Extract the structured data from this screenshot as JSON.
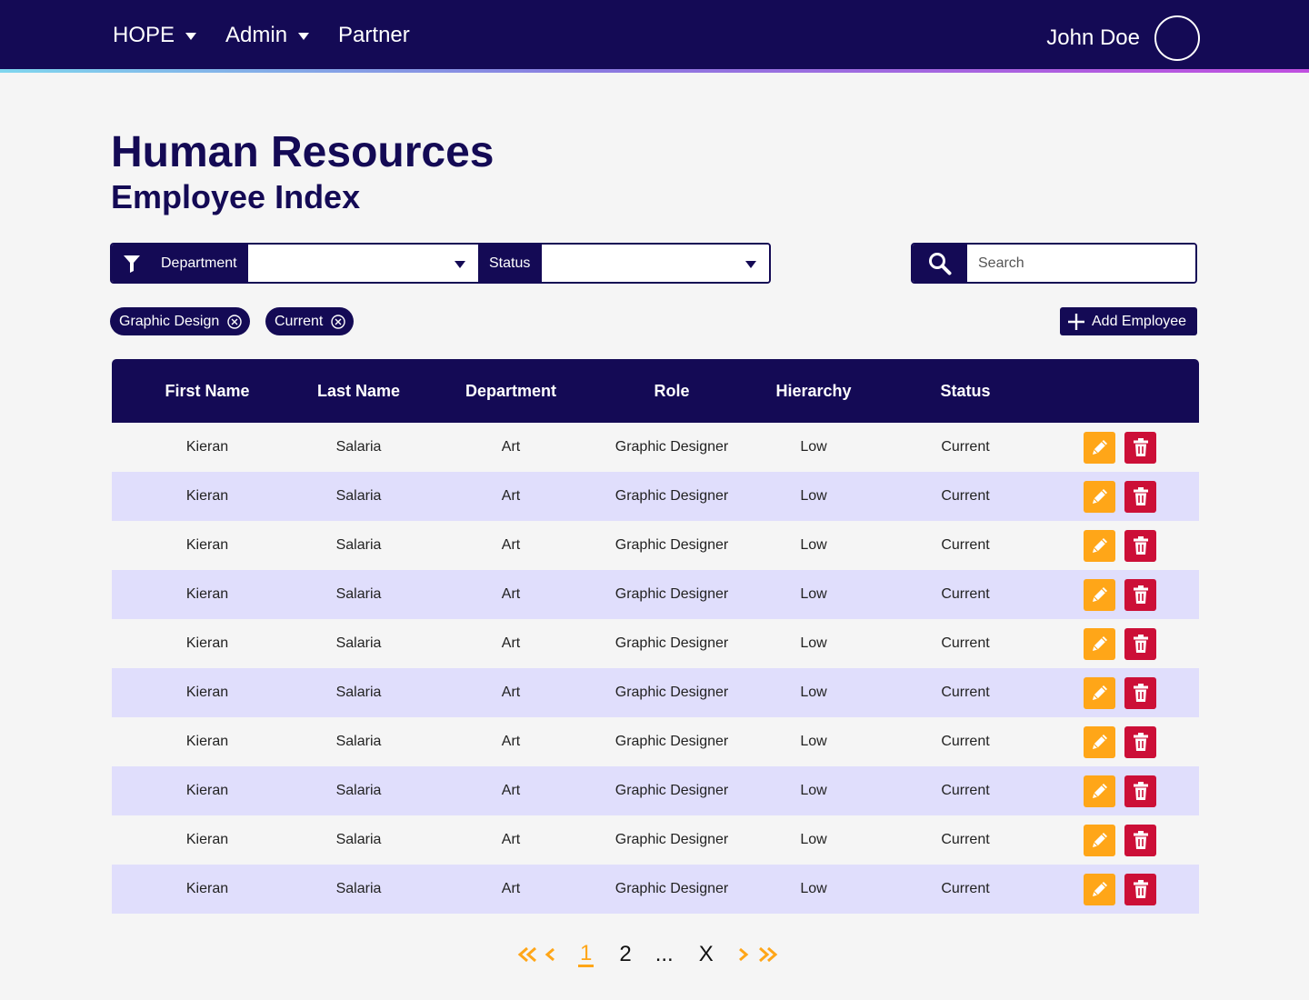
{
  "nav": {
    "items": [
      {
        "label": "HOPE",
        "has_dropdown": true
      },
      {
        "label": "Admin",
        "has_dropdown": true
      },
      {
        "label": "Partner",
        "has_dropdown": false
      }
    ],
    "user_name": "John Doe"
  },
  "page": {
    "title": "Human Resources",
    "subtitle": "Employee Index"
  },
  "filters": {
    "department_label": "Department",
    "department_value": "",
    "status_label": "Status",
    "status_value": ""
  },
  "search": {
    "placeholder": "Search",
    "value": ""
  },
  "active_filters": [
    "Graphic Design",
    "Current"
  ],
  "add_button_label": "Add Employee",
  "table": {
    "headers": [
      "First Name",
      "Last Name",
      "Department",
      "Role",
      "Hierarchy",
      "Status"
    ],
    "rows": [
      [
        "Kieran",
        "Salaria",
        "Art",
        "Graphic Designer",
        "Low",
        "Current"
      ],
      [
        "Kieran",
        "Salaria",
        "Art",
        "Graphic Designer",
        "Low",
        "Current"
      ],
      [
        "Kieran",
        "Salaria",
        "Art",
        "Graphic Designer",
        "Low",
        "Current"
      ],
      [
        "Kieran",
        "Salaria",
        "Art",
        "Graphic Designer",
        "Low",
        "Current"
      ],
      [
        "Kieran",
        "Salaria",
        "Art",
        "Graphic Designer",
        "Low",
        "Current"
      ],
      [
        "Kieran",
        "Salaria",
        "Art",
        "Graphic Designer",
        "Low",
        "Current"
      ],
      [
        "Kieran",
        "Salaria",
        "Art",
        "Graphic Designer",
        "Low",
        "Current"
      ],
      [
        "Kieran",
        "Salaria",
        "Art",
        "Graphic Designer",
        "Low",
        "Current"
      ],
      [
        "Kieran",
        "Salaria",
        "Art",
        "Graphic Designer",
        "Low",
        "Current"
      ],
      [
        "Kieran",
        "Salaria",
        "Art",
        "Graphic Designer",
        "Low",
        "Current"
      ]
    ]
  },
  "pagination": {
    "pages": [
      "1",
      "2",
      "...",
      "X"
    ],
    "current": "1"
  },
  "colors": {
    "primary": "#140a55",
    "accent_gradient": [
      "#7fd6ee",
      "#8a7be0",
      "#c04fe0"
    ],
    "row_alt": "#e0defc",
    "edit": "#ffa618",
    "delete": "#cc0f37",
    "pagination_active": "#ffa618"
  },
  "icons": {
    "filter": "funnel-icon",
    "search": "magnifier-icon",
    "chip_remove": "circle-x-icon",
    "add": "plus-icon",
    "edit": "pencil-icon",
    "delete": "trash-icon",
    "first": "double-chevron-left-icon",
    "prev": "chevron-left-icon",
    "next": "chevron-right-icon",
    "last": "double-chevron-right-icon"
  }
}
